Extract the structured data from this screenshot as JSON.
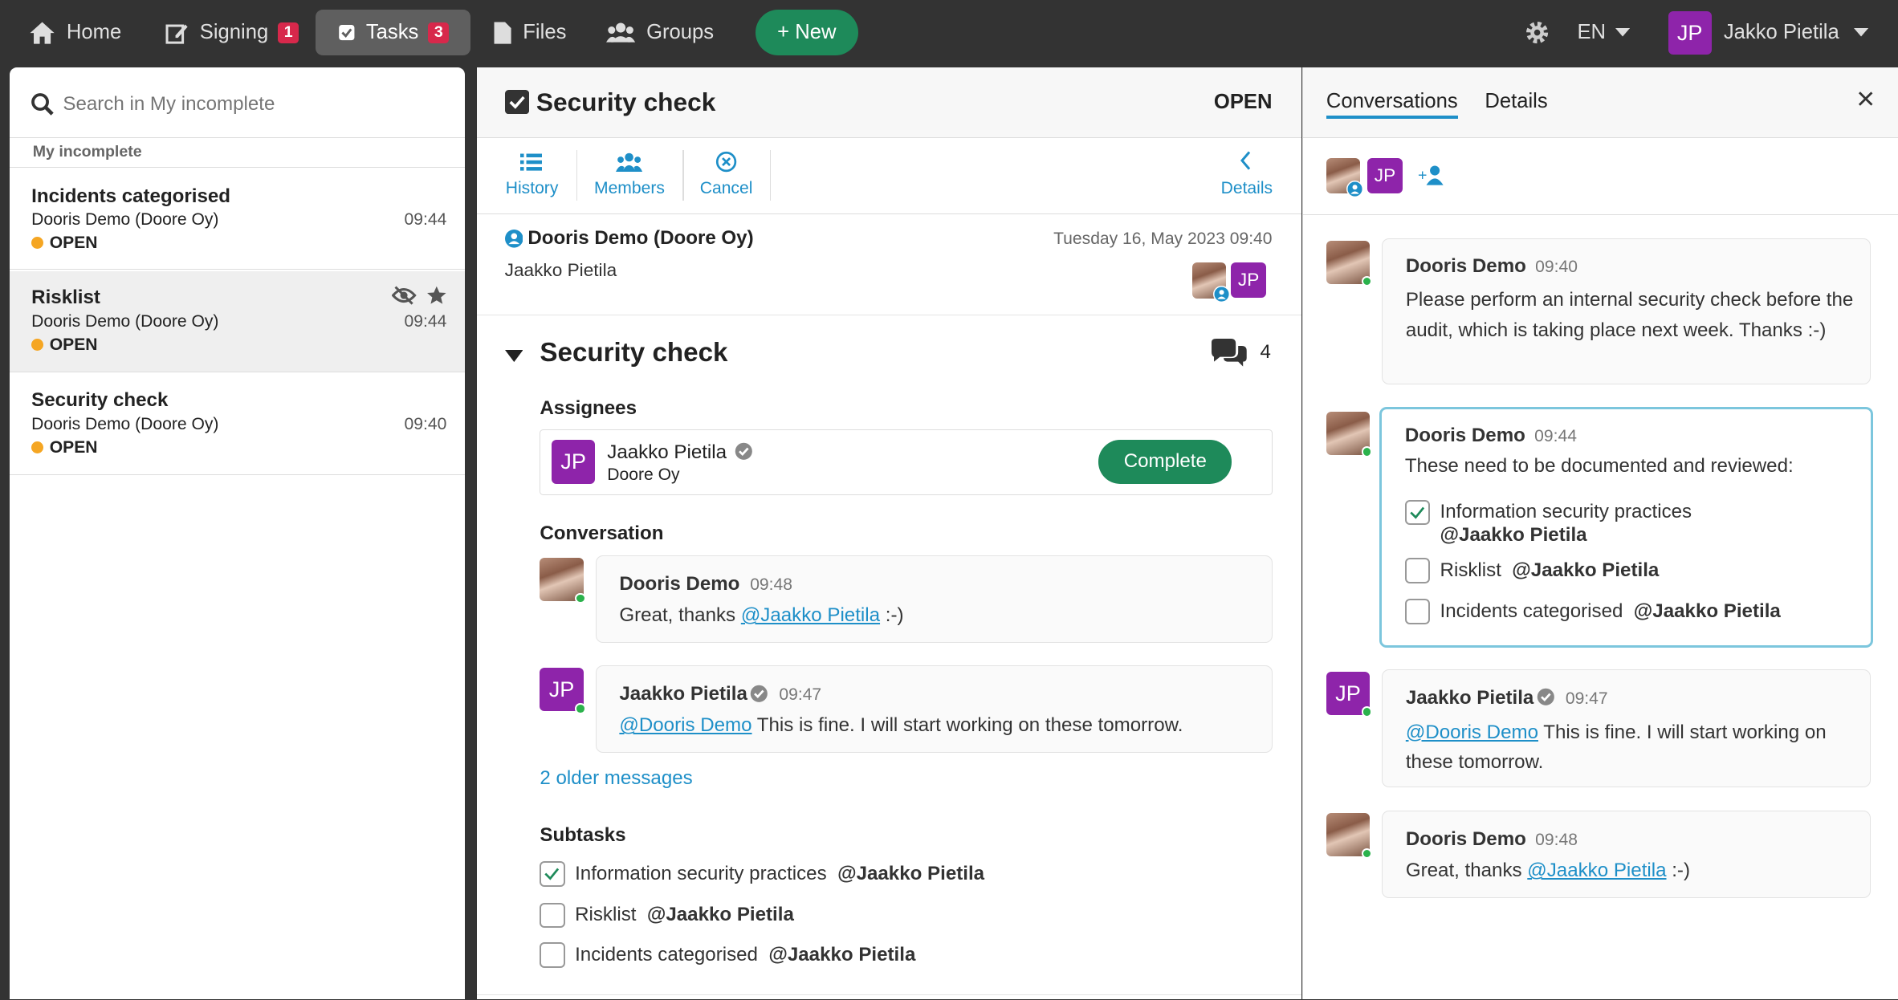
{
  "topnav": {
    "home": "Home",
    "signing": "Signing",
    "signing_badge": "1",
    "tasks": "Tasks",
    "tasks_badge": "3",
    "files": "Files",
    "groups": "Groups",
    "new": "+ New",
    "lang": "EN",
    "user_initials": "JP",
    "user_name": "Jakko Pietila"
  },
  "sidebar": {
    "search_placeholder": "Search in My incomplete",
    "section": "My incomplete",
    "items": [
      {
        "title": "Incidents categorised",
        "org": "Dooris Demo (Doore Oy)",
        "time": "09:44",
        "status": "OPEN"
      },
      {
        "title": "Risklist",
        "org": "Dooris Demo (Doore Oy)",
        "time": "09:44",
        "status": "OPEN"
      },
      {
        "title": "Security check",
        "org": "Dooris Demo (Doore Oy)",
        "time": "09:40",
        "status": "OPEN"
      }
    ]
  },
  "task": {
    "title": "Security check",
    "status": "OPEN",
    "toolbar": {
      "history": "History",
      "members": "Members",
      "cancel": "Cancel",
      "details": "Details"
    },
    "creator": "Dooris Demo (Doore Oy)",
    "assignee_line": "Jaakko Pietila",
    "created": "Tuesday 16, May 2023 09:40",
    "jp": "JP",
    "section_title": "Security check",
    "comment_count": "4",
    "assignees_label": "Assignees",
    "assignee": {
      "initials": "JP",
      "name": "Jaakko Pietila",
      "org": "Doore Oy",
      "complete": "Complete"
    },
    "conversation_label": "Conversation",
    "messages": [
      {
        "author": "Dooris Demo",
        "time": "09:48",
        "pre": "Great, thanks ",
        "mention": "@Jaakko Pietila",
        "post": " :-)"
      },
      {
        "author": "Jaakko Pietila",
        "time": "09:47",
        "mention": "@Dooris Demo",
        "post": " This is fine. I will start working on these tomorrow."
      }
    ],
    "older": "2 older messages",
    "subtasks_label": "Subtasks",
    "subtasks": [
      {
        "text": "Information security practices",
        "mention": "@Jaakko Pietila",
        "done": true
      },
      {
        "text": "Risklist",
        "mention": "@Jaakko Pietila",
        "done": false
      },
      {
        "text": "Incidents categorised",
        "mention": "@Jaakko Pietila",
        "done": false
      }
    ]
  },
  "side": {
    "tab_conversations": "Conversations",
    "tab_details": "Details",
    "close": "×",
    "jp": "JP",
    "add_member": "+",
    "messages": [
      {
        "author": "Dooris Demo",
        "time": "09:40",
        "text": "Please perform an internal security check before the audit, which is taking place next week. Thanks :-)"
      },
      {
        "author": "Dooris Demo",
        "time": "09:44",
        "text": "These need to be documented and reviewed:",
        "items": [
          {
            "text": "Information security practices",
            "mention": "@Jaakko Pietila"
          },
          {
            "text": "Risklist",
            "mention": "@Jaakko Pietila"
          },
          {
            "text": "Incidents categorised",
            "mention": "@Jaakko Pietila"
          }
        ]
      },
      {
        "author": "Jaakko Pietila",
        "time": "09:47",
        "mention": "@Dooris Demo",
        "text": " This is fine. I will start working on these tomorrow."
      },
      {
        "author": "Dooris Demo",
        "time": "09:48",
        "pre": "Great, thanks ",
        "mention": "@Jaakko Pietila",
        "post": " :-)"
      }
    ]
  }
}
